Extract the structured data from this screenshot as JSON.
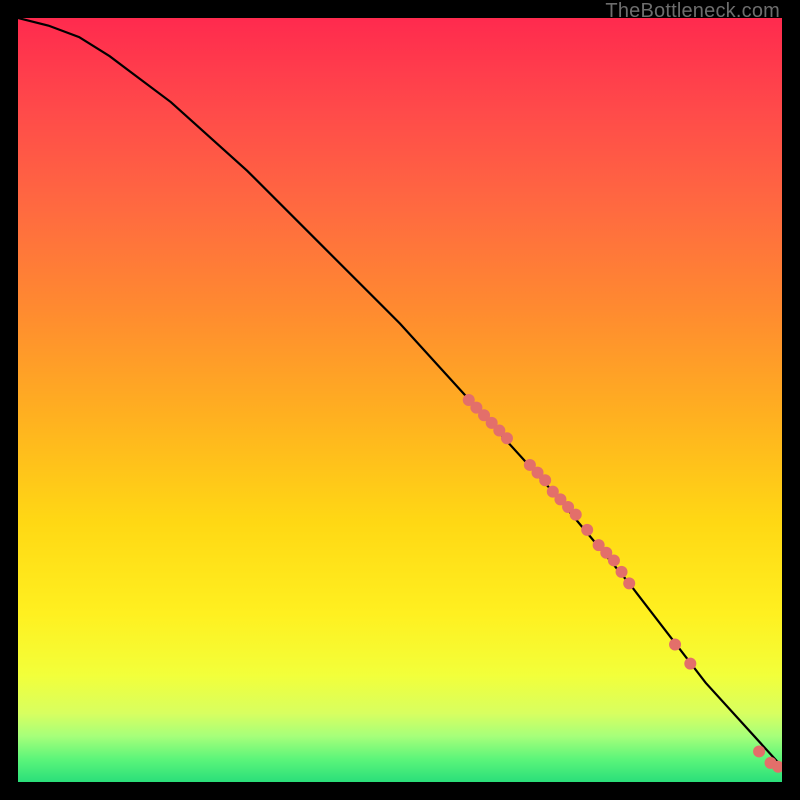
{
  "watermark": "TheBottleneck.com",
  "chart_data": {
    "type": "line",
    "title": "",
    "xlabel": "",
    "ylabel": "",
    "xlim": [
      0,
      100
    ],
    "ylim": [
      0,
      100
    ],
    "grid": false,
    "legend": false,
    "series": [
      {
        "name": "curve",
        "x": [
          0,
          4,
          8,
          12,
          20,
          30,
          40,
          50,
          60,
          70,
          80,
          90,
          100
        ],
        "y": [
          100,
          99,
          97.5,
          95,
          89,
          80,
          70,
          60,
          49,
          38,
          26,
          13,
          2
        ]
      }
    ],
    "markers": {
      "name": "highlighted-points",
      "color": "#e36f6a",
      "radius": 6,
      "points": [
        {
          "x": 59,
          "y": 50
        },
        {
          "x": 60,
          "y": 49
        },
        {
          "x": 61,
          "y": 48
        },
        {
          "x": 62,
          "y": 47
        },
        {
          "x": 63,
          "y": 46
        },
        {
          "x": 64,
          "y": 45
        },
        {
          "x": 67,
          "y": 41.5
        },
        {
          "x": 68,
          "y": 40.5
        },
        {
          "x": 69,
          "y": 39.5
        },
        {
          "x": 70,
          "y": 38
        },
        {
          "x": 71,
          "y": 37
        },
        {
          "x": 72,
          "y": 36
        },
        {
          "x": 73,
          "y": 35
        },
        {
          "x": 74.5,
          "y": 33
        },
        {
          "x": 76,
          "y": 31
        },
        {
          "x": 77,
          "y": 30
        },
        {
          "x": 78,
          "y": 29
        },
        {
          "x": 79,
          "y": 27.5
        },
        {
          "x": 80,
          "y": 26
        },
        {
          "x": 86,
          "y": 18
        },
        {
          "x": 88,
          "y": 15.5
        },
        {
          "x": 97,
          "y": 4
        },
        {
          "x": 98.5,
          "y": 2.5
        },
        {
          "x": 99.5,
          "y": 2
        }
      ]
    },
    "background_gradient": {
      "direction": "vertical",
      "stops": [
        {
          "pos": 0.0,
          "color": "#ff2a4e"
        },
        {
          "pos": 0.25,
          "color": "#ff6a40"
        },
        {
          "pos": 0.52,
          "color": "#ffb020"
        },
        {
          "pos": 0.78,
          "color": "#fff020"
        },
        {
          "pos": 0.91,
          "color": "#d8ff60"
        },
        {
          "pos": 1.0,
          "color": "#2adf7a"
        }
      ]
    }
  }
}
